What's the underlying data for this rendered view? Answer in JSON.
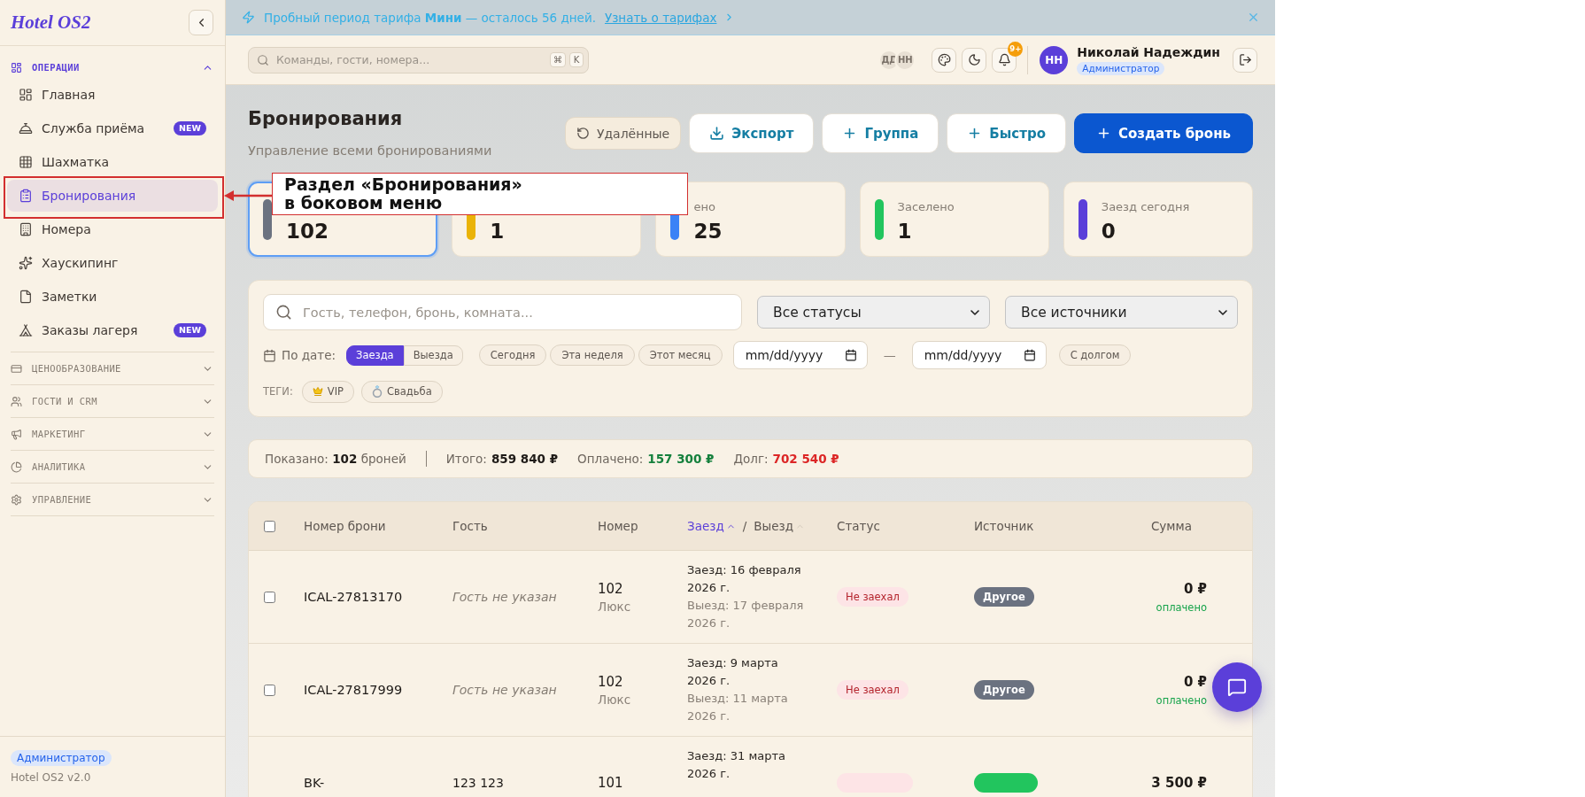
{
  "sidebar": {
    "logo": "Hotel OS2",
    "groups": [
      {
        "label": "ОПЕРАЦИИ",
        "expanded": true,
        "items": [
          {
            "label": "Главная",
            "selected": false
          },
          {
            "label": "Служба приёма",
            "selected": false,
            "badge": "NEW"
          },
          {
            "label": "Шахматка",
            "selected": false
          },
          {
            "label": "Бронирования",
            "selected": true
          },
          {
            "label": "Номера",
            "selected": false
          },
          {
            "label": "Хаускипинг",
            "selected": false
          },
          {
            "label": "Заметки",
            "selected": false
          },
          {
            "label": "Заказы лагеря",
            "selected": false,
            "badge": "NEW"
          }
        ]
      },
      {
        "label": "ЦЕНООБРАЗОВАНИЕ",
        "expanded": false
      },
      {
        "label": "ГОСТИ И CRM",
        "expanded": false
      },
      {
        "label": "МАРКЕТИНГ",
        "expanded": false
      },
      {
        "label": "АНАЛИТИКА",
        "expanded": false
      },
      {
        "label": "УПРАВЛЕНИЕ",
        "expanded": false
      }
    ],
    "footer": {
      "role": "Администратор",
      "version": "Hotel OS2 v2.0"
    }
  },
  "banner": {
    "text": "Пробный период тарифа **Мини** — осталось 56 дней.",
    "link": "Узнать о тарифах"
  },
  "header": {
    "search": {
      "placeholder": "Команды, гости, номера...",
      "keys": [
        "⌘",
        "K"
      ]
    },
    "presence": [
      "ДД",
      "НН"
    ],
    "notifications": "9+",
    "user": {
      "initials": "НН",
      "name": "Николай Надеждин",
      "role": "Администратор"
    }
  },
  "page": {
    "title": "Бронирования",
    "subtitle": "Управление всеми бронированиями",
    "actions": [
      {
        "label": "Удалённые",
        "kind": "soft"
      },
      {
        "label": "Экспорт",
        "kind": "outline"
      },
      {
        "label": "Группа",
        "kind": "outline"
      },
      {
        "label": "Быстро",
        "kind": "outline"
      },
      {
        "label": "Создать бронь",
        "kind": "primary"
      }
    ]
  },
  "stats": [
    {
      "value": "102",
      "color": "#6b7280",
      "selected": true
    },
    {
      "value": "1",
      "color": "#eab308",
      "selected": false
    },
    {
      "label": "ено",
      "value": "25",
      "color": "#3b82f6",
      "selected": false
    },
    {
      "label": "Заселено",
      "value": "1",
      "color": "#22c55e",
      "selected": false
    },
    {
      "label": "Заезд сегодня",
      "value": "0",
      "color": "#5b3fd9",
      "selected": false
    }
  ],
  "filters": {
    "search": {
      "placeholder": "Гость, телефон, бронь, комната..."
    },
    "selects": [
      "Все статусы",
      "Все источники"
    ],
    "date_label": "По дате:",
    "date_modes": [
      {
        "label": "Заезда",
        "selected": true
      },
      {
        "label": "Выезда",
        "selected": false
      }
    ],
    "presets": [
      "Сегодня",
      "Эта неделя",
      "Этот месяц"
    ],
    "date_from": {
      "placeholder": "mm/dd/yyyy"
    },
    "date_separator": "—",
    "date_to": {
      "placeholder": "mm/dd/yyyy"
    },
    "debt_filter": "С долгом",
    "tags_label": "ТЕГИ:",
    "tags": [
      "VIP",
      "Свадьба"
    ]
  },
  "summary": {
    "shown": "Показано: **102** броней",
    "totals": [
      {
        "label": "Итого:",
        "value": "859 840 ₽",
        "kind": "total"
      },
      {
        "label": "Оплачено:",
        "value": "157 300 ₽",
        "kind": "paid"
      },
      {
        "label": "Долг:",
        "value": "702 540 ₽",
        "kind": "debt"
      }
    ]
  },
  "table": {
    "select_all": {
      "checked": false
    },
    "columns": [
      {
        "kind": "text",
        "label": "Номер брони"
      },
      {
        "kind": "text",
        "label": "Гость"
      },
      {
        "kind": "text",
        "label": "Номер"
      },
      {
        "kind": "sort_pair",
        "separator": "/",
        "sorts": [
          {
            "label": "Заезд",
            "selected": true
          },
          {
            "label": "Выезд",
            "selected": false
          }
        ]
      },
      {
        "kind": "text",
        "label": "Статус"
      },
      {
        "kind": "text",
        "label": "Источник"
      },
      {
        "kind": "amount",
        "label": "Сумма"
      }
    ],
    "rows": [
      {
        "checked": false,
        "id": "ICAL-27813170",
        "guest": "Гость не указан",
        "guest_missing": true,
        "room": "102",
        "room_type": "Люкс",
        "check_in": "Заезд: 16 февраля 2026 г.",
        "check_out": "Выезд: 17 февраля 2026 г.",
        "status": {
          "label": "Не заехал",
          "color": "#fde4e6"
        },
        "source": {
          "label": "Другое",
          "color": "#6b7280"
        },
        "amount": "0 ₽",
        "payment": "оплачено"
      },
      {
        "checked": false,
        "id": "ICAL-27817999",
        "guest": "Гость не указан",
        "guest_missing": true,
        "room": "102",
        "room_type": "Люкс",
        "check_in": "Заезд: 9 марта 2026 г.",
        "check_out": "Выезд: 11 марта 2026 г.",
        "status": {
          "label": "Не заехал",
          "color": "#fde4e6"
        },
        "source": {
          "label": "Другое",
          "color": "#6b7280"
        },
        "amount": "0 ₽",
        "payment": "оплачено"
      },
      {
        "id": "BK-",
        "guest": "123 123",
        "guest_missing": false,
        "room": "101",
        "check_in": "Заезд: 31 марта 2026 г.",
        "status": {
          "color": "#fde4e6"
        },
        "source": {
          "color": "#22c55e"
        },
        "amount": "3 500 ₽"
      }
    ]
  },
  "annotation": {
    "text": "Раздел «Бронирования»\nв боковом меню"
  }
}
